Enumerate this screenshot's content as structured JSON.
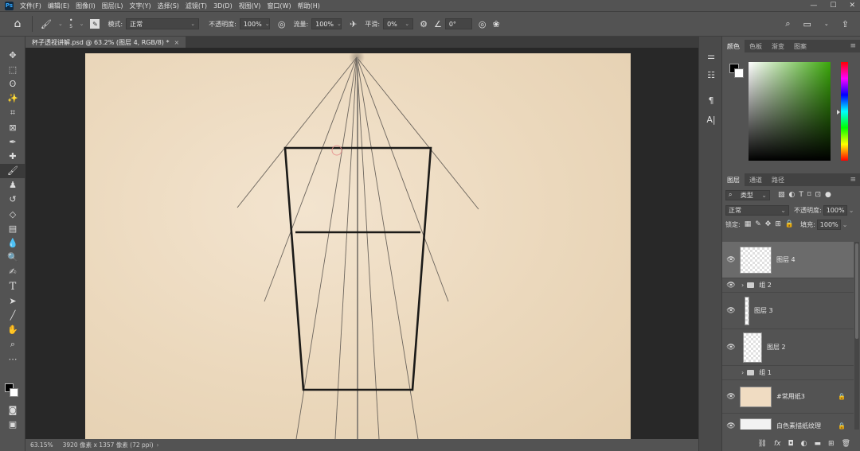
{
  "app": {
    "logo": "Ps"
  },
  "menubar": [
    "文件(F)",
    "编辑(E)",
    "图像(I)",
    "图层(L)",
    "文字(Y)",
    "选择(S)",
    "滤镜(T)",
    "3D(D)",
    "视图(V)",
    "窗口(W)",
    "帮助(H)"
  ],
  "window_controls": {
    "minimize": "—",
    "maximize": "☐",
    "close": "✕"
  },
  "options": {
    "brush_size": "5",
    "mode_label": "模式:",
    "mode_value": "正常",
    "opacity_label": "不透明度:",
    "opacity_value": "100%",
    "flow_label": "流量:",
    "flow_value": "100%",
    "smooth_label": "平滑:",
    "smooth_value": "0%",
    "angle_value": "0°"
  },
  "document": {
    "tab_title": "杯子透视讲解.psd @ 63.2% (图层 4, RGB/8) *",
    "zoom": "63.15%",
    "dimensions": "3920 像素 x 1357 像素 (72 ppi)"
  },
  "color_panel": {
    "tabs": [
      "颜色",
      "色板",
      "渐变",
      "图案"
    ]
  },
  "layers_panel": {
    "tabs": [
      "图层",
      "通道",
      "路径"
    ],
    "filter_kind": "类型",
    "blend_mode": "正常",
    "opacity_label": "不透明度:",
    "opacity_value": "100%",
    "lock_label": "锁定:",
    "fill_label": "填充:",
    "fill_value": "100%",
    "layers": [
      {
        "name": "图层 4",
        "type": "layer",
        "visible": true,
        "selected": true
      },
      {
        "name": "组 2",
        "type": "group",
        "visible": true
      },
      {
        "name": "图层 3",
        "type": "layer",
        "visible": true
      },
      {
        "name": "图层 2",
        "type": "layer",
        "visible": true
      },
      {
        "name": "组 1",
        "type": "group",
        "visible": false
      },
      {
        "name": "#常用纸3",
        "type": "layer",
        "visible": true,
        "locked": true
      },
      {
        "name": "白色素描纸纹理",
        "type": "layer",
        "visible": true,
        "locked": true
      }
    ]
  }
}
